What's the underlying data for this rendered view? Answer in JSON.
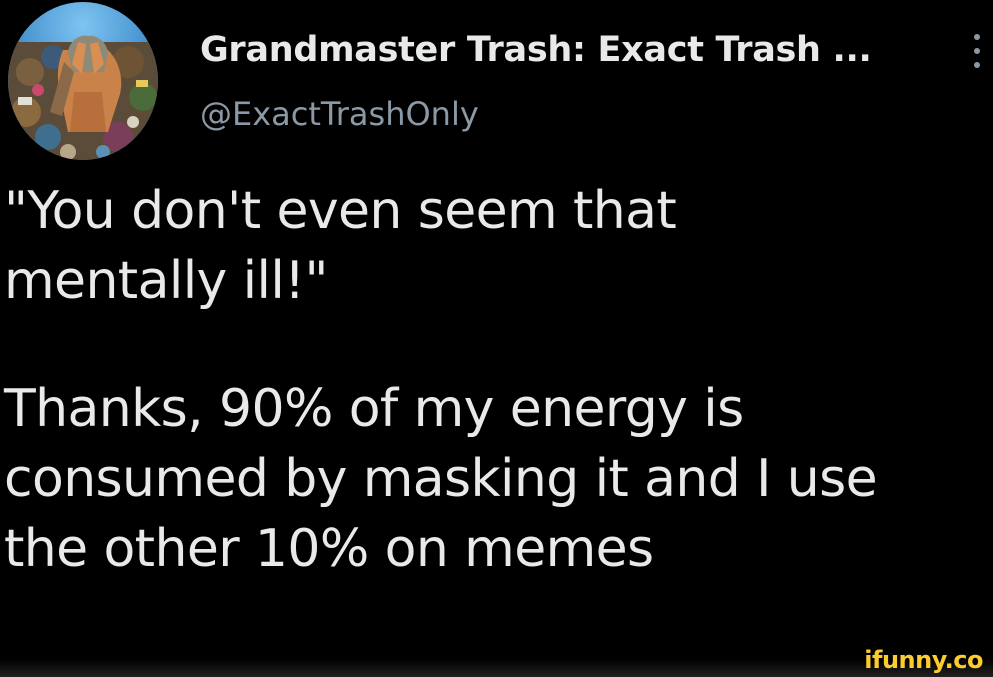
{
  "tweet": {
    "author": {
      "display_name": "Grandmaster Trash: Exact Trash ...",
      "handle": "@ExactTrashOnly",
      "avatar_icon": "avatar-trash-heap-photo"
    },
    "more_icon": "vertical-ellipsis-icon",
    "text_lines": [
      "\"You don't even seem that",
      "mentally ill!\"",
      "Thanks, 90% of my energy is",
      "consumed by masking it and I use",
      "the other 10% on memes"
    ]
  },
  "watermark": {
    "text": "ifunny.co",
    "color": "#fecb2e"
  },
  "colors": {
    "background": "#000000",
    "primary_text": "#e7e9ea",
    "secondary_text": "#8b98a5"
  }
}
